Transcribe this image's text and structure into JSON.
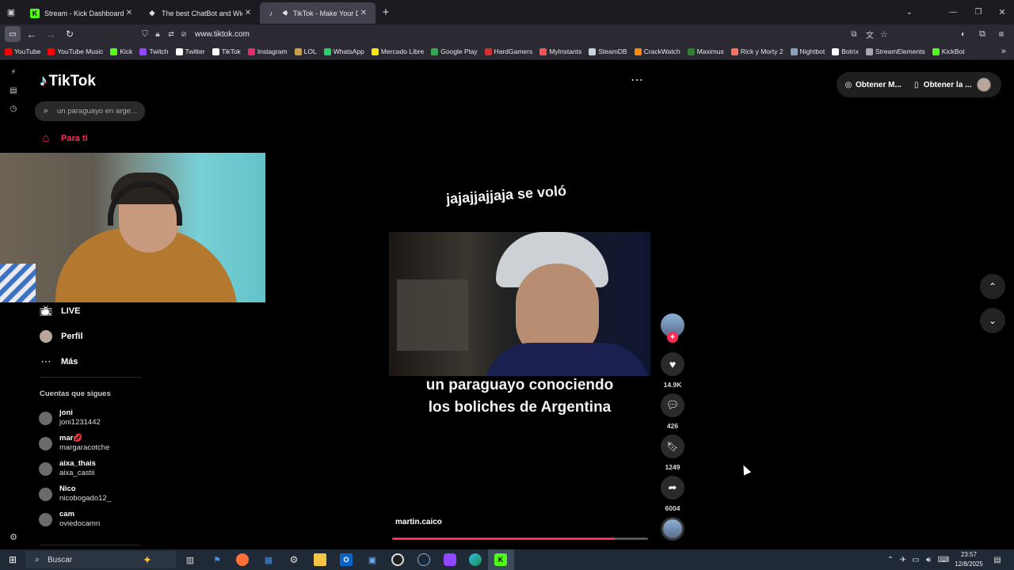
{
  "browser": {
    "tabs": [
      {
        "title": "Stream - Kick Dashboard"
      },
      {
        "title": "The best ChatBot and Widgets"
      },
      {
        "title": "TikTok - Make Your Day"
      }
    ],
    "url": "www.tiktok.com",
    "bookmarks": [
      {
        "label": "YouTube",
        "color": "#ff0000"
      },
      {
        "label": "YouTube Music",
        "color": "#ff0000"
      },
      {
        "label": "Kick",
        "color": "#53fc18"
      },
      {
        "label": "Twitch",
        "color": "#9146ff"
      },
      {
        "label": "Twitter",
        "color": "#ffffff"
      },
      {
        "label": "TikTok",
        "color": "#ffffff"
      },
      {
        "label": "Instagram",
        "color": "#e1306c"
      },
      {
        "label": "LOL",
        "color": "#c8a04b"
      },
      {
        "label": "WhatsApp",
        "color": "#25d366"
      },
      {
        "label": "Mercado Libre",
        "color": "#ffe600"
      },
      {
        "label": "Google Play",
        "color": "#34a853"
      },
      {
        "label": "HardGamers",
        "color": "#d32f2f"
      },
      {
        "label": "MyInstants",
        "color": "#ff5252"
      },
      {
        "label": "SteamDB",
        "color": "#c6d4df"
      },
      {
        "label": "CrackWatch",
        "color": "#ff8a00"
      },
      {
        "label": "Maximus",
        "color": "#2e7d32"
      },
      {
        "label": "Rick y Morty 2",
        "color": "#ff6f61"
      },
      {
        "label": "Nightbot",
        "color": "#8aa0b8"
      },
      {
        "label": "Botrix",
        "color": "#ffffff"
      },
      {
        "label": "StreamElements",
        "color": "#aaaaaa"
      },
      {
        "label": "KickBot",
        "color": "#53fc18"
      }
    ]
  },
  "tiktok": {
    "logo": "TikTok",
    "search_placeholder": "un paraguayo en arge...",
    "nav": {
      "for_you": "Para ti",
      "live": "LIVE",
      "profile": "Perfil",
      "more": "Más"
    },
    "following_heading": "Cuentas que sigues",
    "following": [
      {
        "name": "joni",
        "handle": "joni1231442"
      },
      {
        "name": "mar💋",
        "handle": "margaracotche"
      },
      {
        "name": "aixa_thais",
        "handle": "aixa_castii"
      },
      {
        "name": "Nico",
        "handle": "nicobogado12_"
      },
      {
        "name": "cam",
        "handle": "oviedocamn"
      }
    ],
    "top_buttons": {
      "coins": "Obtener M...",
      "app": "Obtener la ..."
    },
    "video": {
      "caption_top": "jajajjajjaja se voló",
      "caption_bottom_1": "un paraguayo conociendo",
      "caption_bottom_2": "los boliches de Argentina",
      "author": "martin.caico",
      "progress": 0.87
    },
    "actions": {
      "likes": "14.9K",
      "comments": "426",
      "saves": "1249",
      "shares": "6004"
    }
  },
  "taskbar": {
    "search": "Buscar",
    "time": "23:57",
    "date": "12/8/2025"
  }
}
